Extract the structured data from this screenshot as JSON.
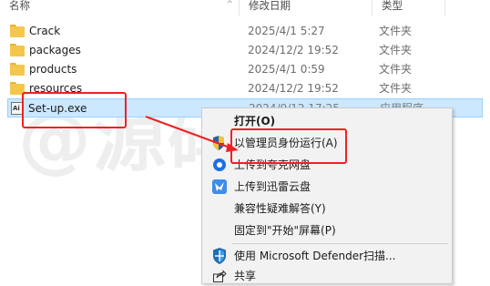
{
  "header": {
    "name": "名称",
    "date": "修改日期",
    "type": "类型",
    "size": "",
    "sort_arrow": "^"
  },
  "files": [
    {
      "name": "Crack",
      "date": "2025/4/1 5:27",
      "type": "文件夹",
      "icon": "folder-icon"
    },
    {
      "name": "packages",
      "date": "2024/12/2 19:52",
      "type": "文件夹",
      "icon": "folder-icon"
    },
    {
      "name": "products",
      "date": "2025/4/1 0:59",
      "type": "文件夹",
      "icon": "folder-icon"
    },
    {
      "name": "resources",
      "date": "2024/12/2 19:52",
      "type": "文件夹",
      "icon": "folder-icon"
    },
    {
      "name": "Set-up.exe",
      "date": "2024/9/12 17:25",
      "type": "应用程序",
      "icon": "exe-icon",
      "icon_text": "Ai",
      "selected": true
    }
  ],
  "context_menu": {
    "open": "打开(O)",
    "run_as_admin": "以管理员身份运行(A)",
    "upload_quark": "上传到夸克网盘",
    "upload_xunlei": "上传到迅雷云盘",
    "compat_troubleshoot": "兼容性疑难解答(Y)",
    "pin_start": "固定到\"开始\"屏幕(P)",
    "defender_scan": "使用 Microsoft Defender扫描...",
    "share": "共享"
  },
  "watermark": "@源码风",
  "colors": {
    "selection_bg": "#cce8ff",
    "highlight_red": "#ee2222",
    "folder_yellow": "#f3c74e",
    "menu_bg": "#f2f2f2"
  }
}
